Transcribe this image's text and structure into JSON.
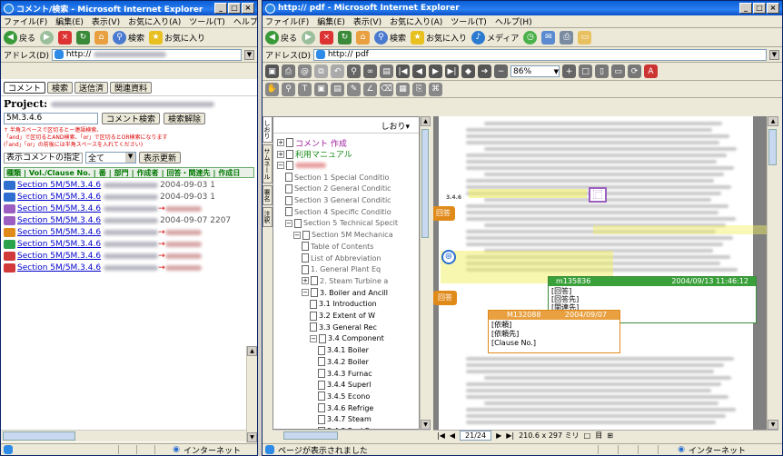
{
  "left": {
    "title": "コメント/検索 - Microsoft Internet Explorer",
    "menu": [
      "ファイル(F)",
      "編集(E)",
      "表示(V)",
      "お気に入り(A)",
      "ツール(T)",
      "ヘルプ(H)"
    ],
    "toolbar": {
      "back": "戻る",
      "search": "検索",
      "favorites": "お気に入り"
    },
    "address": {
      "label": "アドレス(D)",
      "value": "http://"
    },
    "tabs": [
      "コメント",
      "検索",
      "送信済",
      "関連資料"
    ],
    "project_label": "Project:",
    "search_value": "5M.3.4.6",
    "comment_search_button": "コメント検索",
    "search_clear_button": "検索解除",
    "notes": [
      "↑ 半角スペースで区切るとー連語検索、",
      "「and」で区切るとAND検索、「or」で区切るとOR検索になります",
      "(「and」「or」の前後には半角スペースを入れてください)"
    ],
    "filter_label": "表示コメントの指定",
    "filter_value": "全て",
    "refresh_button": "表示更新",
    "columns": [
      "種類",
      "Vol./Clause No.",
      "番",
      "部門",
      "作成者",
      "回答・関連先",
      "作成日"
    ],
    "rows": [
      {
        "link": "Section 5M/5M.3.4.6",
        "date": "2004-09-03 1",
        "color": "#2f6fd0",
        "arrow": false
      },
      {
        "link": "Section 5M/5M.3.4.6",
        "date": "2004-09-03 1",
        "color": "#2f6fd0",
        "arrow": false
      },
      {
        "link": "Section 5M/5M.3.4.6",
        "date": "",
        "color": "#9a5fc0",
        "arrow": true
      },
      {
        "link": "Section 5M/5M.3.4.6",
        "date": "2004-09-07 2207",
        "color": "#9a5fc0",
        "arrow": false
      },
      {
        "link": "Section 5M/5M.3.4.6",
        "date": "",
        "color": "#e08a1a",
        "arrow": true
      },
      {
        "link": "Section 5M/5M.3.4.6",
        "date": "",
        "color": "#2aa34a",
        "arrow": true
      },
      {
        "link": "Section 5M/5M.3.4.6",
        "date": "",
        "color": "#d23a3a",
        "arrow": true
      },
      {
        "link": "Section 5M/5M.3.4.6",
        "date": "",
        "color": "#d23a3a",
        "arrow": true
      }
    ],
    "status": "インターネット"
  },
  "right": {
    "title": "http:// pdf - Microsoft Internet Explorer",
    "menu": [
      "ファイル(F)",
      "編集(E)",
      "表示(V)",
      "お気に入り(A)",
      "ツール(T)",
      "ヘルプ(H)"
    ],
    "toolbar": {
      "back": "戻る",
      "search": "検索",
      "favorites": "お気に入り",
      "media": "メディア"
    },
    "address": {
      "label": "アドレス(D)",
      "value": "http:// pdf"
    },
    "zoom": "86%",
    "bookmarks_label": "しおり▾",
    "side_tabs": [
      "しおり",
      "サムネール",
      "署名",
      "注釈"
    ],
    "tree": [
      {
        "label": "コメント 作成",
        "depth": 0,
        "expander": "+",
        "color": "#a020a0"
      },
      {
        "label": "利用マニュアル",
        "depth": 0,
        "expander": "+",
        "color": "#1a8a1a"
      },
      {
        "label": "",
        "depth": 0,
        "expander": "−",
        "color": "#d02020"
      },
      {
        "label": "Section 1 Special Conditio",
        "depth": 1,
        "expander": "",
        "color": ""
      },
      {
        "label": "Section 2 General Conditic",
        "depth": 1,
        "expander": "",
        "color": ""
      },
      {
        "label": "Section 3 General Conditic",
        "depth": 1,
        "expander": "",
        "color": ""
      },
      {
        "label": "Section 4 Specific Conditio",
        "depth": 1,
        "expander": "",
        "color": ""
      },
      {
        "label": "Section 5 Technical Specit",
        "depth": 1,
        "expander": "−",
        "color": ""
      },
      {
        "label": "Section 5M Mechanica",
        "depth": 2,
        "expander": "−",
        "color": ""
      },
      {
        "label": "Table of Contents",
        "depth": 3,
        "expander": "",
        "color": ""
      },
      {
        "label": "List of Abbreviation",
        "depth": 3,
        "expander": "",
        "color": ""
      },
      {
        "label": "1. General Plant Eq",
        "depth": 3,
        "expander": "",
        "color": ""
      },
      {
        "label": "2. Steam Turbine a",
        "depth": 3,
        "expander": "+",
        "color": ""
      },
      {
        "label": "3. Boiler and Ancill",
        "depth": 3,
        "expander": "−",
        "color": "#000"
      },
      {
        "label": "3.1 Introduction",
        "depth": 4,
        "expander": "",
        "color": "#000"
      },
      {
        "label": "3.2 Extent of W",
        "depth": 4,
        "expander": "",
        "color": "#000"
      },
      {
        "label": "3.3 General Rec",
        "depth": 4,
        "expander": "",
        "color": "#000"
      },
      {
        "label": "3.4 Component",
        "depth": 4,
        "expander": "−",
        "color": "#000"
      },
      {
        "label": "3.4.1 Boiler",
        "depth": 5,
        "expander": "",
        "color": "#000"
      },
      {
        "label": "3.4.2 Boiler",
        "depth": 5,
        "expander": "",
        "color": "#000"
      },
      {
        "label": "3.4.3 Furnac",
        "depth": 5,
        "expander": "",
        "color": "#000"
      },
      {
        "label": "3.4.4 Superl",
        "depth": 5,
        "expander": "",
        "color": "#000"
      },
      {
        "label": "3.4.5 Econo",
        "depth": 5,
        "expander": "",
        "color": "#000"
      },
      {
        "label": "3.4.6 Refrige",
        "depth": 5,
        "expander": "",
        "color": "#000"
      },
      {
        "label": "3.4.7 Steam",
        "depth": 5,
        "expander": "",
        "color": "#000"
      },
      {
        "label": "3.4.8 Fuel F",
        "depth": 5,
        "expander": "",
        "color": "#000"
      }
    ],
    "section_number": "3.4.6",
    "comment1": {
      "user": "m135836",
      "datetime": "2004/09/13 11:46:12",
      "lines": [
        "[回答]",
        "[回答先]",
        "[関連先]",
        "[Clause No.]"
      ]
    },
    "comment2": {
      "user": "M132088",
      "datetime": "2004/09/07",
      "lines": [
        "[依頼]",
        "[依頼先]",
        "[Clause No.]"
      ]
    },
    "nav": {
      "page": "21/24",
      "size": "210.6 x 297 ミリ"
    },
    "status": "ページが表示されました",
    "zone": "インターネット"
  }
}
